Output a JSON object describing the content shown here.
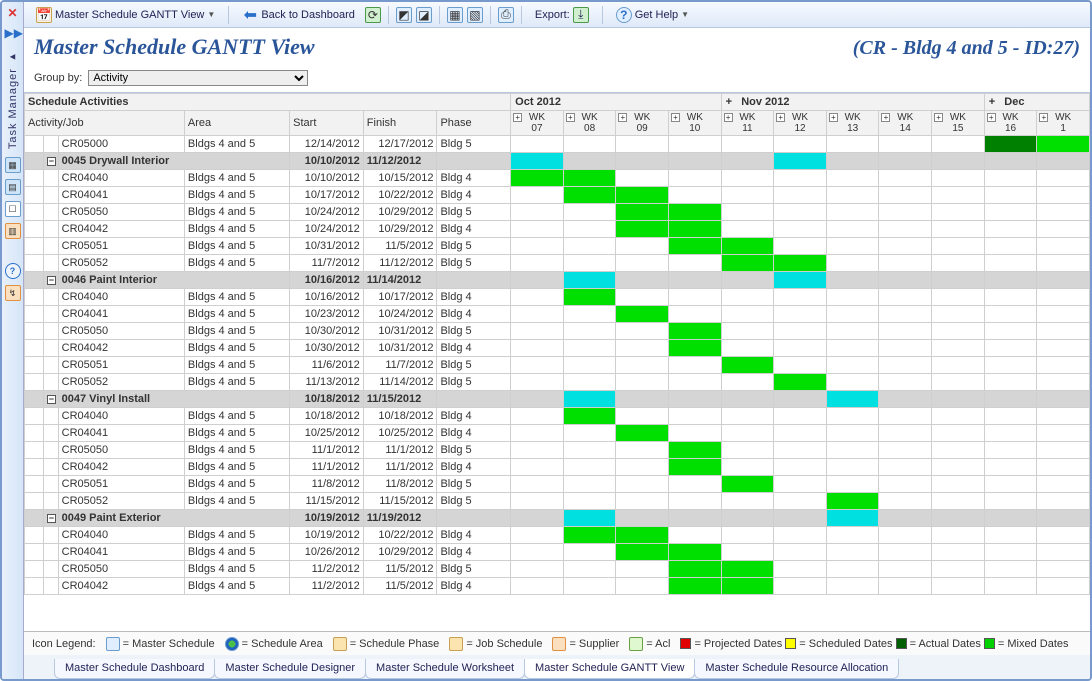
{
  "toolbar": {
    "title_btn": "Master Schedule GANTT View",
    "back": "Back to Dashboard",
    "export": "Export:",
    "help": "Get Help"
  },
  "header": {
    "title": "Master Schedule GANTT View",
    "project": "(CR - Bldg 4 and 5 - ID:27)"
  },
  "groupby": {
    "label": "Group by:",
    "value": "Activity"
  },
  "columns": {
    "section": "Schedule Activities",
    "c0": "Activity/Job",
    "c1": "Area",
    "c2": "Start",
    "c3": "Finish",
    "c4": "Phase"
  },
  "months": [
    "Oct 2012",
    "Nov 2012",
    "Dec"
  ],
  "weeks": [
    "WK 07",
    "WK 08",
    "WK 09",
    "WK 10",
    "WK 11",
    "WK 12",
    "WK 13",
    "WK 14",
    "WK 15",
    "WK 16",
    "WK 1"
  ],
  "rows": [
    {
      "t": "row",
      "job": "CR05000",
      "area": "Bldgs 4 and 5",
      "start": "12/14/2012",
      "finish": "12/17/2012",
      "phase": "Bldg 5",
      "bars": [
        {
          "w": 9,
          "color": "dg",
          "span": 1
        },
        {
          "w": 10,
          "color": "g",
          "span": 1
        }
      ]
    },
    {
      "t": "grp",
      "job": "0045 Drywall Interior",
      "start": "10/10/2012",
      "finish": "11/12/2012",
      "bars": [
        {
          "w": 0,
          "color": "c",
          "span": 1
        },
        {
          "w": 5,
          "color": "c",
          "span": 1
        }
      ]
    },
    {
      "t": "row",
      "job": "CR04040",
      "area": "Bldgs 4 and 5",
      "start": "10/10/2012",
      "finish": "10/15/2012",
      "phase": "Bldg 4",
      "bars": [
        {
          "w": 0,
          "color": "g",
          "span": 1
        },
        {
          "w": 1,
          "color": "g",
          "span": 1
        }
      ]
    },
    {
      "t": "row",
      "job": "CR04041",
      "area": "Bldgs 4 and 5",
      "start": "10/17/2012",
      "finish": "10/22/2012",
      "phase": "Bldg 4",
      "bars": [
        {
          "w": 1,
          "color": "g",
          "span": 1
        },
        {
          "w": 2,
          "color": "g",
          "span": 1
        }
      ]
    },
    {
      "t": "row",
      "job": "CR05050",
      "area": "Bldgs 4 and 5",
      "start": "10/24/2012",
      "finish": "10/29/2012",
      "phase": "Bldg 5",
      "bars": [
        {
          "w": 2,
          "color": "g",
          "span": 1
        },
        {
          "w": 3,
          "color": "g",
          "span": 1
        }
      ]
    },
    {
      "t": "row",
      "job": "CR04042",
      "area": "Bldgs 4 and 5",
      "start": "10/24/2012",
      "finish": "10/29/2012",
      "phase": "Bldg 4",
      "bars": [
        {
          "w": 2,
          "color": "g",
          "span": 1
        },
        {
          "w": 3,
          "color": "g",
          "span": 1
        }
      ]
    },
    {
      "t": "row",
      "job": "CR05051",
      "area": "Bldgs 4 and 5",
      "start": "10/31/2012",
      "finish": "11/5/2012",
      "phase": "Bldg 5",
      "bars": [
        {
          "w": 3,
          "color": "g",
          "span": 1
        },
        {
          "w": 4,
          "color": "g",
          "span": 1
        }
      ]
    },
    {
      "t": "row",
      "job": "CR05052",
      "area": "Bldgs 4 and 5",
      "start": "11/7/2012",
      "finish": "11/12/2012",
      "phase": "Bldg 5",
      "bars": [
        {
          "w": 4,
          "color": "g",
          "span": 1
        },
        {
          "w": 5,
          "color": "g",
          "span": 1
        }
      ]
    },
    {
      "t": "grp",
      "job": "0046 Paint Interior",
      "start": "10/16/2012",
      "finish": "11/14/2012",
      "bars": [
        {
          "w": 1,
          "color": "c",
          "span": 1
        },
        {
          "w": 5,
          "color": "c",
          "span": 1
        }
      ]
    },
    {
      "t": "row",
      "job": "CR04040",
      "area": "Bldgs 4 and 5",
      "start": "10/16/2012",
      "finish": "10/17/2012",
      "phase": "Bldg 4",
      "bars": [
        {
          "w": 1,
          "color": "g",
          "span": 1
        }
      ]
    },
    {
      "t": "row",
      "job": "CR04041",
      "area": "Bldgs 4 and 5",
      "start": "10/23/2012",
      "finish": "10/24/2012",
      "phase": "Bldg 4",
      "bars": [
        {
          "w": 2,
          "color": "g",
          "span": 1
        }
      ]
    },
    {
      "t": "row",
      "job": "CR05050",
      "area": "Bldgs 4 and 5",
      "start": "10/30/2012",
      "finish": "10/31/2012",
      "phase": "Bldg 5",
      "bars": [
        {
          "w": 3,
          "color": "g",
          "span": 1
        }
      ]
    },
    {
      "t": "row",
      "job": "CR04042",
      "area": "Bldgs 4 and 5",
      "start": "10/30/2012",
      "finish": "10/31/2012",
      "phase": "Bldg 4",
      "bars": [
        {
          "w": 3,
          "color": "g",
          "span": 1
        }
      ]
    },
    {
      "t": "row",
      "job": "CR05051",
      "area": "Bldgs 4 and 5",
      "start": "11/6/2012",
      "finish": "11/7/2012",
      "phase": "Bldg 5",
      "bars": [
        {
          "w": 4,
          "color": "g",
          "span": 1
        }
      ]
    },
    {
      "t": "row",
      "job": "CR05052",
      "area": "Bldgs 4 and 5",
      "start": "11/13/2012",
      "finish": "11/14/2012",
      "phase": "Bldg 5",
      "bars": [
        {
          "w": 5,
          "color": "g",
          "span": 1
        }
      ]
    },
    {
      "t": "grp",
      "job": "0047 Vinyl Install",
      "start": "10/18/2012",
      "finish": "11/15/2012",
      "bars": [
        {
          "w": 1,
          "color": "c",
          "span": 1
        },
        {
          "w": 6,
          "color": "c",
          "span": 1
        }
      ]
    },
    {
      "t": "row",
      "job": "CR04040",
      "area": "Bldgs 4 and 5",
      "start": "10/18/2012",
      "finish": "10/18/2012",
      "phase": "Bldg 4",
      "bars": [
        {
          "w": 1,
          "color": "g",
          "span": 1
        }
      ]
    },
    {
      "t": "row",
      "job": "CR04041",
      "area": "Bldgs 4 and 5",
      "start": "10/25/2012",
      "finish": "10/25/2012",
      "phase": "Bldg 4",
      "bars": [
        {
          "w": 2,
          "color": "g",
          "span": 1
        }
      ]
    },
    {
      "t": "row",
      "job": "CR05050",
      "area": "Bldgs 4 and 5",
      "start": "11/1/2012",
      "finish": "11/1/2012",
      "phase": "Bldg 5",
      "bars": [
        {
          "w": 3,
          "color": "g",
          "span": 1
        }
      ]
    },
    {
      "t": "row",
      "job": "CR04042",
      "area": "Bldgs 4 and 5",
      "start": "11/1/2012",
      "finish": "11/1/2012",
      "phase": "Bldg 4",
      "bars": [
        {
          "w": 3,
          "color": "g",
          "span": 1
        }
      ]
    },
    {
      "t": "row",
      "job": "CR05051",
      "area": "Bldgs 4 and 5",
      "start": "11/8/2012",
      "finish": "11/8/2012",
      "phase": "Bldg 5",
      "bars": [
        {
          "w": 4,
          "color": "g",
          "span": 1
        }
      ]
    },
    {
      "t": "row",
      "job": "CR05052",
      "area": "Bldgs 4 and 5",
      "start": "11/15/2012",
      "finish": "11/15/2012",
      "phase": "Bldg 5",
      "bars": [
        {
          "w": 6,
          "color": "g",
          "span": 1
        }
      ]
    },
    {
      "t": "grp",
      "job": "0049 Paint Exterior",
      "start": "10/19/2012",
      "finish": "11/19/2012",
      "bars": [
        {
          "w": 1,
          "color": "c",
          "span": 1
        },
        {
          "w": 6,
          "color": "c",
          "span": 1
        }
      ]
    },
    {
      "t": "row",
      "job": "CR04040",
      "area": "Bldgs 4 and 5",
      "start": "10/19/2012",
      "finish": "10/22/2012",
      "phase": "Bldg 4",
      "bars": [
        {
          "w": 1,
          "color": "g",
          "span": 1
        },
        {
          "w": 2,
          "color": "g",
          "span": 1
        }
      ]
    },
    {
      "t": "row",
      "job": "CR04041",
      "area": "Bldgs 4 and 5",
      "start": "10/26/2012",
      "finish": "10/29/2012",
      "phase": "Bldg 4",
      "bars": [
        {
          "w": 2,
          "color": "g",
          "span": 1
        },
        {
          "w": 3,
          "color": "g",
          "span": 1
        }
      ]
    },
    {
      "t": "row",
      "job": "CR05050",
      "area": "Bldgs 4 and 5",
      "start": "11/2/2012",
      "finish": "11/5/2012",
      "phase": "Bldg 5",
      "bars": [
        {
          "w": 3,
          "color": "g",
          "span": 1
        },
        {
          "w": 4,
          "color": "g",
          "span": 1
        }
      ]
    },
    {
      "t": "row",
      "job": "CR04042",
      "area": "Bldgs 4 and 5",
      "start": "11/2/2012",
      "finish": "11/5/2012",
      "phase": "Bldg 4",
      "bars": [
        {
          "w": 3,
          "color": "g",
          "span": 1
        },
        {
          "w": 4,
          "color": "g",
          "span": 1
        }
      ]
    }
  ],
  "legend": {
    "label": "Icon Legend:",
    "items": [
      "= Master Schedule",
      "= Schedule Area",
      "= Schedule Phase",
      "= Job Schedule",
      "= Supplier",
      "= Acl"
    ],
    "colors": [
      {
        "c": "red",
        "t": "= Projected Dates"
      },
      {
        "c": "yellow",
        "t": "= Scheduled Dates"
      },
      {
        "c": "dgreen",
        "t": "= Actual Dates"
      },
      {
        "c": "green",
        "t": "= Mixed Dates"
      }
    ]
  },
  "tabs": [
    "Master Schedule Dashboard",
    "Master Schedule Designer",
    "Master Schedule Worksheet",
    "Master Schedule GANTT View",
    "Master Schedule Resource Allocation"
  ],
  "active_tab": 3
}
